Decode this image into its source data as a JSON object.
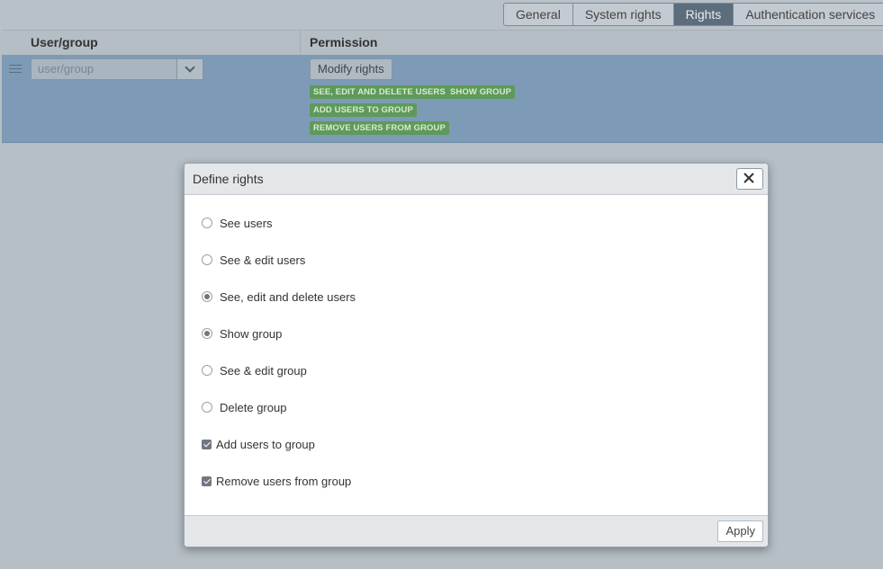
{
  "tabs": [
    {
      "label": "General",
      "active": false
    },
    {
      "label": "System rights",
      "active": false
    },
    {
      "label": "Rights",
      "active": true
    },
    {
      "label": "Authentication services",
      "active": false
    }
  ],
  "table": {
    "columns": [
      "User/group",
      "Permission"
    ],
    "row": {
      "user_group_placeholder": "user/group",
      "modify_button": "Modify rights",
      "badges": [
        "SEE, EDIT AND DELETE USERS",
        "SHOW GROUP",
        "ADD USERS TO GROUP",
        "REMOVE USERS FROM GROUP"
      ]
    }
  },
  "dialog": {
    "title": "Define rights",
    "options": [
      {
        "label": "See users",
        "type": "radio",
        "checked": false
      },
      {
        "label": "See & edit users",
        "type": "radio",
        "checked": false
      },
      {
        "label": "See, edit and delete users",
        "type": "radio",
        "checked": true
      },
      {
        "label": "Show group",
        "type": "radio",
        "checked": true
      },
      {
        "label": "See & edit group",
        "type": "radio",
        "checked": false
      },
      {
        "label": "Delete group",
        "type": "radio",
        "checked": false
      },
      {
        "label": "Add users to group",
        "type": "checkbox",
        "checked": true
      },
      {
        "label": "Remove users from group",
        "type": "checkbox",
        "checked": true
      }
    ],
    "apply_label": "Apply"
  },
  "colors": {
    "selected_row": "#7d9bb6",
    "badge_green": "#5e9a5a",
    "active_tab": "#5c6d7d"
  }
}
